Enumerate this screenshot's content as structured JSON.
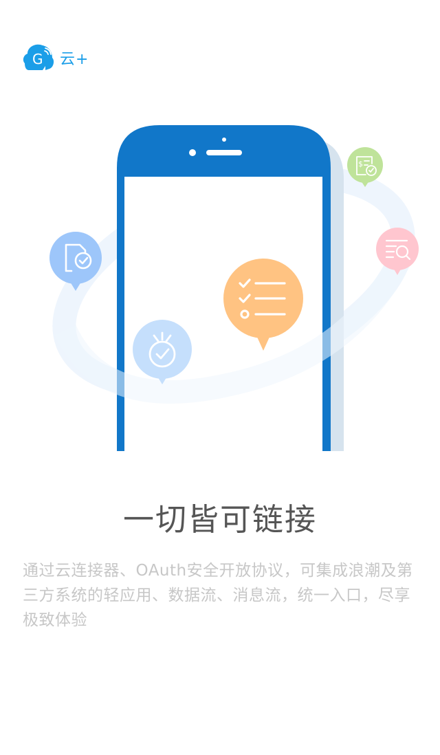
{
  "brand": {
    "name": "云+",
    "logo_letter": "G"
  },
  "page": {
    "title": "一切皆可链接",
    "description": "通过云连接器、OAuth安全开放协议，可集成浪潮及第三方系统的轻应用、数据流、消息流，统一入口，尽享极致体验"
  },
  "colors": {
    "brand_blue": "#1b9ee8",
    "phone_blue": "#1177c9",
    "orbit": "#eef5fd",
    "bubble_blue": "#9dc6fa",
    "bubble_light_blue": "#c5dffc",
    "bubble_orange": "#ffc382",
    "bubble_green": "#bfe39a",
    "bubble_pink": "#ffc6cf",
    "title_text": "#555555",
    "desc_text": "#c7c7c7"
  },
  "illustration": {
    "icons": [
      "document-check-icon",
      "medal-icon",
      "checklist-icon",
      "invoice-check-icon",
      "search-list-icon"
    ]
  }
}
